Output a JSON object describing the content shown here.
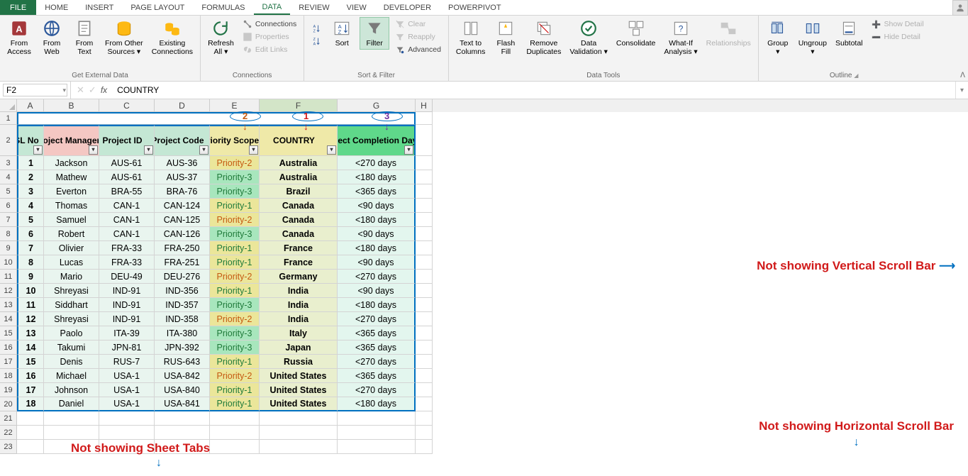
{
  "tabs": {
    "file": "FILE",
    "items": [
      "HOME",
      "INSERT",
      "PAGE LAYOUT",
      "FORMULAS",
      "DATA",
      "REVIEW",
      "VIEW",
      "DEVELOPER",
      "POWERPIVOT"
    ],
    "active_index": 4
  },
  "ribbon": {
    "groups": {
      "get_external": {
        "label": "Get External Data",
        "from_access": "From\nAccess",
        "from_web": "From\nWeb",
        "from_text": "From\nText",
        "from_other": "From Other\nSources ▾",
        "existing_conn": "Existing\nConnections"
      },
      "connections": {
        "label": "Connections",
        "refresh_all": "Refresh\nAll ▾",
        "connections": "Connections",
        "properties": "Properties",
        "edit_links": "Edit Links"
      },
      "sort_filter": {
        "label": "Sort & Filter",
        "sort": "Sort",
        "filter": "Filter",
        "clear": "Clear",
        "reapply": "Reapply",
        "advanced": "Advanced"
      },
      "data_tools": {
        "label": "Data Tools",
        "text_to_columns": "Text to\nColumns",
        "flash_fill": "Flash\nFill",
        "remove_dup": "Remove\nDuplicates",
        "data_val": "Data\nValidation ▾",
        "consolidate": "Consolidate",
        "whatif": "What-If\nAnalysis ▾",
        "relationships": "Relationships"
      },
      "outline": {
        "label": "Outline",
        "group": "Group\n▾",
        "ungroup": "Ungroup\n▾",
        "subtotal": "Subtotal",
        "show_detail": "Show Detail",
        "hide_detail": "Hide Detail"
      }
    }
  },
  "name_box": "F2",
  "formula_bar": "COUNTRY",
  "columns": [
    "A",
    "B",
    "C",
    "D",
    "E",
    "F",
    "G",
    "H"
  ],
  "header_row": [
    "SL No",
    "Project Manager",
    "Project ID",
    "Project Code",
    "Priority Scope",
    "COUNTRY",
    "Project Completion Days"
  ],
  "rows": [
    {
      "r": 3,
      "d": [
        "1",
        "Jackson",
        "AUS-61",
        "AUS-36",
        "Priority-2",
        "Australia",
        "<270 days"
      ]
    },
    {
      "r": 4,
      "d": [
        "2",
        "Mathew",
        "AUS-61",
        "AUS-37",
        "Priority-3",
        "Australia",
        "<180 days"
      ]
    },
    {
      "r": 5,
      "d": [
        "3",
        "Everton",
        "BRA-55",
        "BRA-76",
        "Priority-3",
        "Brazil",
        "<365 days"
      ]
    },
    {
      "r": 6,
      "d": [
        "4",
        "Thomas",
        "CAN-1",
        "CAN-124",
        "Priority-1",
        "Canada",
        "<90 days"
      ]
    },
    {
      "r": 7,
      "d": [
        "5",
        "Samuel",
        "CAN-1",
        "CAN-125",
        "Priority-2",
        "Canada",
        "<180 days"
      ]
    },
    {
      "r": 8,
      "d": [
        "6",
        "Robert",
        "CAN-1",
        "CAN-126",
        "Priority-3",
        "Canada",
        "<90 days"
      ]
    },
    {
      "r": 9,
      "d": [
        "7",
        "Olivier",
        "FRA-33",
        "FRA-250",
        "Priority-1",
        "France",
        "<180 days"
      ]
    },
    {
      "r": 10,
      "d": [
        "8",
        "Lucas",
        "FRA-33",
        "FRA-251",
        "Priority-1",
        "France",
        "<90 days"
      ]
    },
    {
      "r": 11,
      "d": [
        "9",
        "Mario",
        "DEU-49",
        "DEU-276",
        "Priority-2",
        "Germany",
        "<270 days"
      ]
    },
    {
      "r": 12,
      "d": [
        "10",
        "Shreyasi",
        "IND-91",
        "IND-356",
        "Priority-1",
        "India",
        "<90 days"
      ]
    },
    {
      "r": 13,
      "d": [
        "11",
        "Siddhart",
        "IND-91",
        "IND-357",
        "Priority-3",
        "India",
        "<180 days"
      ]
    },
    {
      "r": 14,
      "d": [
        "12",
        "Shreyasi",
        "IND-91",
        "IND-358",
        "Priority-2",
        "India",
        "<270 days"
      ]
    },
    {
      "r": 15,
      "d": [
        "13",
        "Paolo",
        "ITA-39",
        "ITA-380",
        "Priority-3",
        "Italy",
        "<365 days"
      ]
    },
    {
      "r": 16,
      "d": [
        "14",
        "Takumi",
        "JPN-81",
        "JPN-392",
        "Priority-3",
        "Japan",
        "<365 days"
      ]
    },
    {
      "r": 17,
      "d": [
        "15",
        "Denis",
        "RUS-7",
        "RUS-643",
        "Priority-1",
        "Russia",
        "<270 days"
      ]
    },
    {
      "r": 18,
      "d": [
        "16",
        "Michael",
        "USA-1",
        "USA-842",
        "Priority-2",
        "United States",
        "<365 days"
      ]
    },
    {
      "r": 19,
      "d": [
        "17",
        "Johnson",
        "USA-1",
        "USA-840",
        "Priority-1",
        "United States",
        "<270 days"
      ]
    },
    {
      "r": 20,
      "d": [
        "18",
        "Daniel",
        "USA-1",
        "USA-841",
        "Priority-1",
        "United States",
        "<180 days"
      ]
    }
  ],
  "empty_rows": [
    21,
    22,
    23
  ],
  "annotations": {
    "vscroll": "Not showing Vertical Scroll Bar",
    "hscroll": "Not showing Horizontal Scroll Bar",
    "tabs": "Not showing Sheet Tabs",
    "n1": "1",
    "n2": "2",
    "n3": "3"
  }
}
